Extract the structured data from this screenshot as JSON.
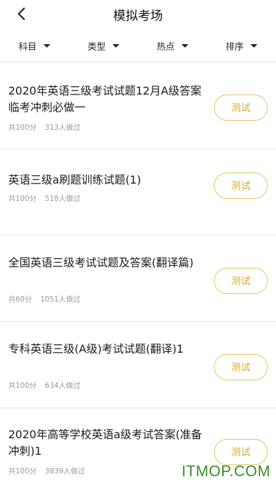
{
  "header": {
    "title": "模拟考场",
    "back_icon": "chevron-left-icon"
  },
  "filters": [
    {
      "label": "科目"
    },
    {
      "label": "类型"
    },
    {
      "label": "热点"
    },
    {
      "label": "排序"
    }
  ],
  "items": [
    {
      "title": "2020年英语三级考试试题12月A级答案临考冲刺必做一",
      "score": "共100分",
      "count": "313人做过",
      "button": "测试"
    },
    {
      "title": "英语三级a刷题训练试题(1)",
      "score": "共100分",
      "count": "518人做过",
      "button": "测试"
    },
    {
      "title": "全国英语三级考试试题及答案(翻译篇)",
      "score": "共60分",
      "count": "1051人做过",
      "button": "测试"
    },
    {
      "title": "专科英语三级(A级)考试试题(翻译)1",
      "score": "共100分",
      "count": "634人做过",
      "button": "测试"
    },
    {
      "title": "2020年高等学校英语a级考试答案(准备冲刺)1",
      "score": "共100分",
      "count": "3839人做过",
      "button": "测试"
    }
  ],
  "watermark": "ITMOP.COM",
  "colors": {
    "accent": "#d7a92e",
    "accent_border": "#e6c25a",
    "meta": "#999999",
    "watermark": "#3a8f2a"
  }
}
